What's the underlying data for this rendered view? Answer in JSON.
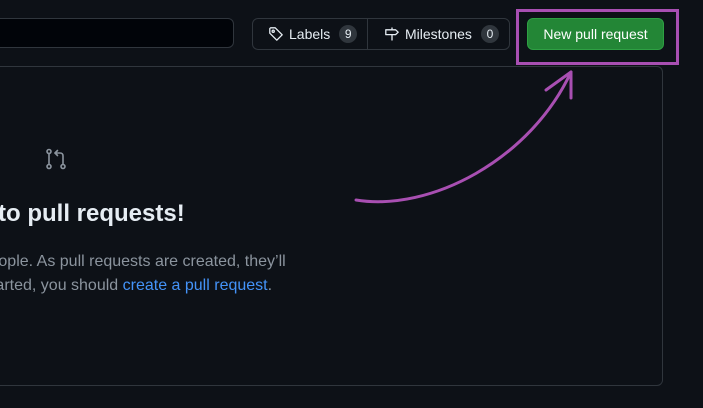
{
  "search": {
    "value": ""
  },
  "toolbar": {
    "labels": {
      "label": "Labels",
      "count": "9"
    },
    "milestones": {
      "label": "Milestones",
      "count": "0"
    },
    "new_pr_label": "New pull request"
  },
  "blankslate": {
    "title": "ome to pull requests!",
    "desc_line1": "ide with other people. As pull requests are created, they’ll",
    "desc_line2_prefix": "ple list. To get started, you should ",
    "link_text": "create a pull request",
    "desc_suffix": "."
  },
  "icons": [
    "tag-icon",
    "milestone-icon",
    "git-pull-request-icon"
  ],
  "colors": {
    "background": "#0d1117",
    "primary_button": "#238636",
    "annotation": "#a84fb2",
    "link": "#4493f8",
    "muted_text": "#8b949e"
  }
}
